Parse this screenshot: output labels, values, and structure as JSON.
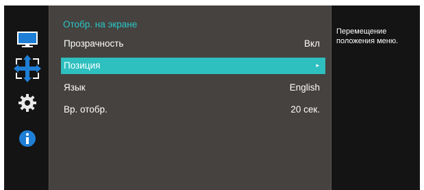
{
  "sidebar": {
    "icons": [
      "monitor-icon",
      "move-arrows-icon",
      "gear-icon",
      "info-icon"
    ]
  },
  "menu": {
    "title": "Отобр. на экране",
    "items": [
      {
        "label": "Прозрачность",
        "value": "Вкл"
      },
      {
        "label": "Позиция",
        "value": "▸"
      },
      {
        "label": "Язык",
        "value": "English"
      },
      {
        "label": "Вр. отобр.",
        "value": "20 сек."
      }
    ],
    "selected_index": 1
  },
  "help": {
    "text": "Перемещение положения меню."
  },
  "colors": {
    "accent": "#2ebfbf",
    "title": "#2ac8c8",
    "panel": "#45423f",
    "background": "#141414"
  }
}
